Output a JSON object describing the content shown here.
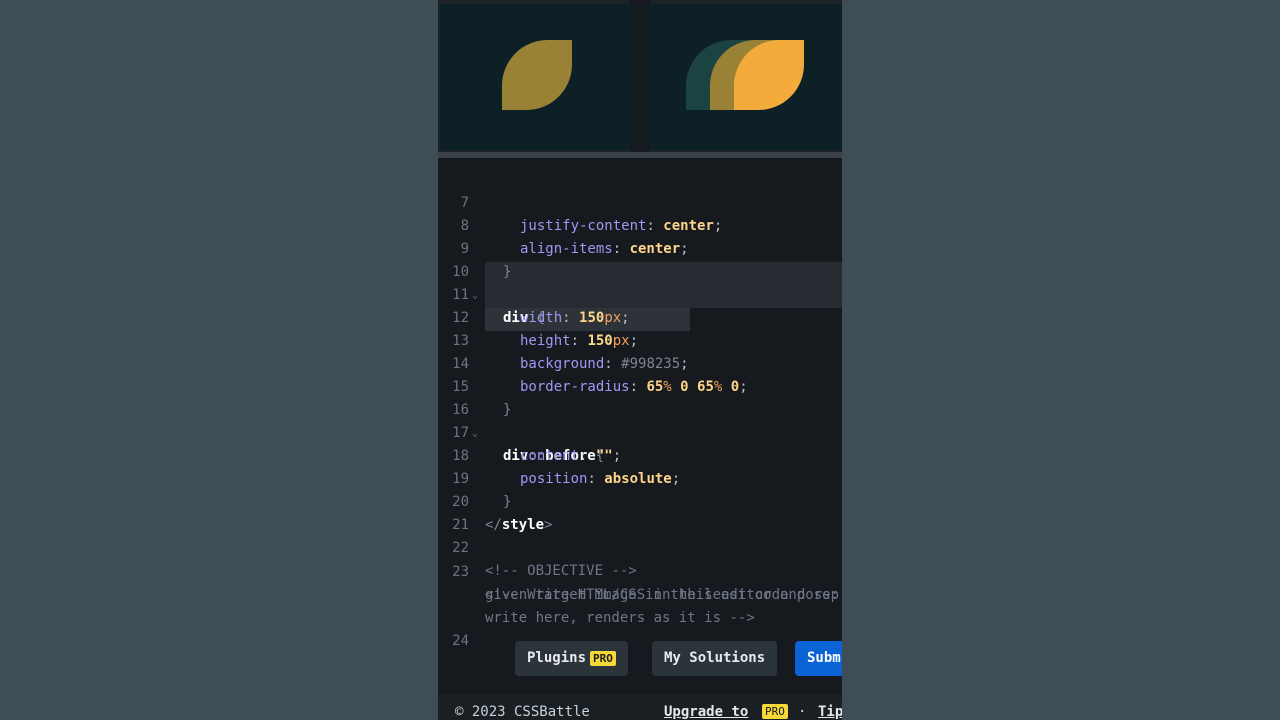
{
  "colors": {
    "output_bg": "#0c2025",
    "target_bg": "#0c2025",
    "output_leaf": "#998235",
    "target_leaf_back": "#1a4341",
    "target_leaf_mid": "#998235",
    "target_leaf_front": "#f3ac3c"
  },
  "code_lines": [
    {
      "n": "7"
    },
    {
      "n": "8"
    },
    {
      "n": "9"
    },
    {
      "n": "10"
    },
    {
      "n": "11"
    },
    {
      "n": "12"
    },
    {
      "n": "13"
    },
    {
      "n": "14"
    },
    {
      "n": "15"
    },
    {
      "n": "16"
    },
    {
      "n": "17"
    },
    {
      "n": "18"
    },
    {
      "n": "19"
    },
    {
      "n": "20"
    },
    {
      "n": "21"
    },
    {
      "n": "22"
    },
    {
      "n": "23"
    },
    {
      "n": "24"
    }
  ],
  "code": {
    "l7_prop": "justify-content",
    "l7_val": "center",
    "l8_prop": "align-items",
    "l8_val": "center",
    "l10_sel": "div",
    "l11_prop": "width",
    "l11_num": "150",
    "l11_unit": "px",
    "l12_prop": "height",
    "l12_num": "150",
    "l12_unit": "px",
    "l13_prop": "background",
    "l13_val": "#998235",
    "l14_prop": "border-radius",
    "l14_num1": "65",
    "l14_rest": "0",
    "l14_num2": "65",
    "l14_end": "0",
    "l16_sel": "div",
    "l16_pseudo": "before",
    "l17_prop": "content",
    "l17_val": "\"\"",
    "l18_prop": "position",
    "l18_val": "absolute",
    "l20_tag": "style",
    "l22_comment": "<!-- OBJECTIVE -->",
    "l23_comment_a": "<!-- Write HTML/CSS in this editor and rep",
    "l23_comment_b": "given target image in the least code poss:",
    "l23_comment_c": "write here, renders as it is -->"
  },
  "buttons": {
    "plugins": "Plugins",
    "my_solutions": "My Solutions",
    "submit": "Subm",
    "pro_badge": "PRO"
  },
  "footer": {
    "copyright": "© 2023 CSSBattle",
    "upgrade": "Upgrade to",
    "pro_badge": "PRO",
    "dot": "·",
    "tip": "Tip"
  }
}
